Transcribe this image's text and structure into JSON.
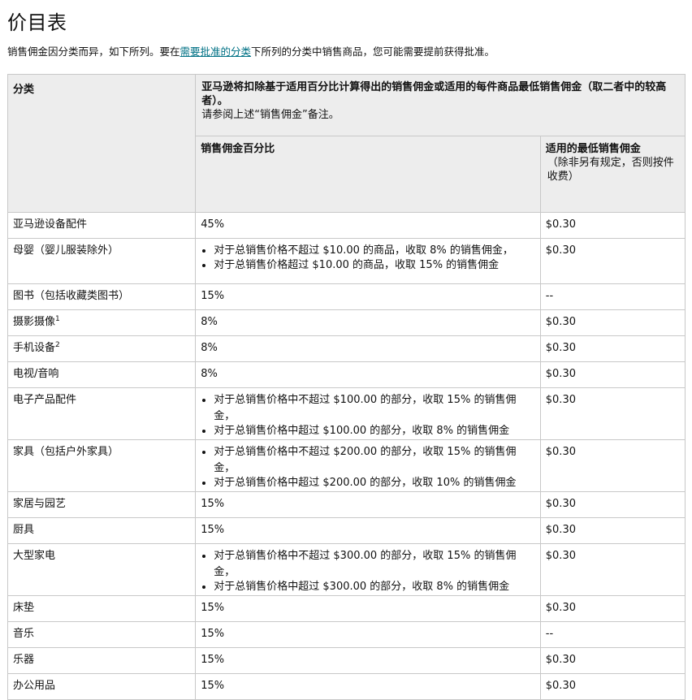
{
  "page": {
    "title": "价目表",
    "intro_before": "销售佣金因分类而异，如下所列。要在",
    "intro_link": "需要批准的分类",
    "intro_after": "下所列的分类中销售商品，您可能需要提前获得批准。"
  },
  "table": {
    "header_category": "分类",
    "header_span_bold": "亚马逊将扣除基于适用百分比计算得出的销售佣金或适用的每件商品最低销售佣金（取二者中的较高者）。",
    "header_span_note": "请参阅上述“销售佣金”备注。",
    "header_percent": "销售佣金百分比",
    "header_min_bold": "适用的最低销售佣金",
    "header_min_note": "（除非另有规定，否则按件收费）",
    "rows": [
      {
        "category": "亚马逊设备配件",
        "percent": "45%",
        "min": "$0.30"
      },
      {
        "category": "母婴（婴儿服装除外）",
        "bullets": [
          "对于总销售价格不超过 $10.00 的商品，收取 8% 的销售佣金，",
          "对于总销售价格超过 $10.00 的商品，收取 15% 的销售佣金"
        ],
        "min": "$0.30"
      },
      {
        "category": "图书（包括收藏类图书）",
        "percent": "15%",
        "min": "--"
      },
      {
        "category": "摄影摄像",
        "sup": "1",
        "percent": "8%",
        "min": "$0.30"
      },
      {
        "category": "手机设备",
        "sup": "2",
        "percent": "8%",
        "min": "$0.30"
      },
      {
        "category": "电视/音响",
        "percent": "8%",
        "min": "$0.30"
      },
      {
        "category": "电子产品配件",
        "bullets": [
          "对于总销售价格中不超过 $100.00 的部分，收取 15% 的销售佣金，",
          "对于总销售价格中超过 $100.00 的部分，收取 8% 的销售佣金"
        ],
        "min": "$0.30"
      },
      {
        "category": "家具（包括户外家具）",
        "bullets": [
          "对于总销售价格中不超过 $200.00 的部分，收取 15% 的销售佣金，",
          "对于总销售价格中超过 $200.00 的部分，收取 10% 的销售佣金"
        ],
        "min": "$0.30"
      },
      {
        "category": "家居与园艺",
        "percent": "15%",
        "min": "$0.30"
      },
      {
        "category": "厨具",
        "percent": "15%",
        "min": "$0.30"
      },
      {
        "category": "大型家电",
        "bullets": [
          "对于总销售价格中不超过 $300.00 的部分，收取 15% 的销售佣金，",
          "对于总销售价格中超过 $300.00 的部分，收取 8% 的销售佣金"
        ],
        "min": "$0.30"
      },
      {
        "category": "床垫",
        "percent": "15%",
        "min": "$0.30"
      },
      {
        "category": "音乐",
        "percent": "15%",
        "min": "--"
      },
      {
        "category": "乐器",
        "percent": "15%",
        "min": "$0.30"
      },
      {
        "category": "办公用品",
        "percent": "15%",
        "min": "$0.30"
      }
    ]
  }
}
